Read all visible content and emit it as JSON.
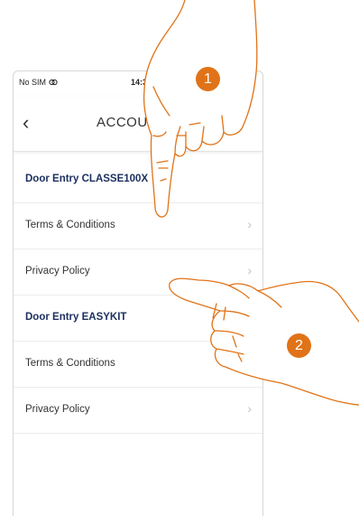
{
  "status_bar": {
    "carrier": "No SIM",
    "time": "14:30"
  },
  "nav": {
    "back_icon": "chevron-left-icon",
    "title": "ACCOUNT"
  },
  "list": {
    "rows": [
      {
        "label": "Door Entry CLASSE100X",
        "type": "header"
      },
      {
        "label": "Terms & Conditions",
        "type": "item"
      },
      {
        "label": "Privacy Policy",
        "type": "item"
      },
      {
        "label": "Door Entry EASYKIT",
        "type": "header"
      },
      {
        "label": "Terms & Conditions",
        "type": "item"
      },
      {
        "label": "Privacy Policy",
        "type": "item"
      }
    ]
  },
  "annotations": {
    "step1": "1",
    "step2": "2",
    "accent_color": "#e07318"
  }
}
